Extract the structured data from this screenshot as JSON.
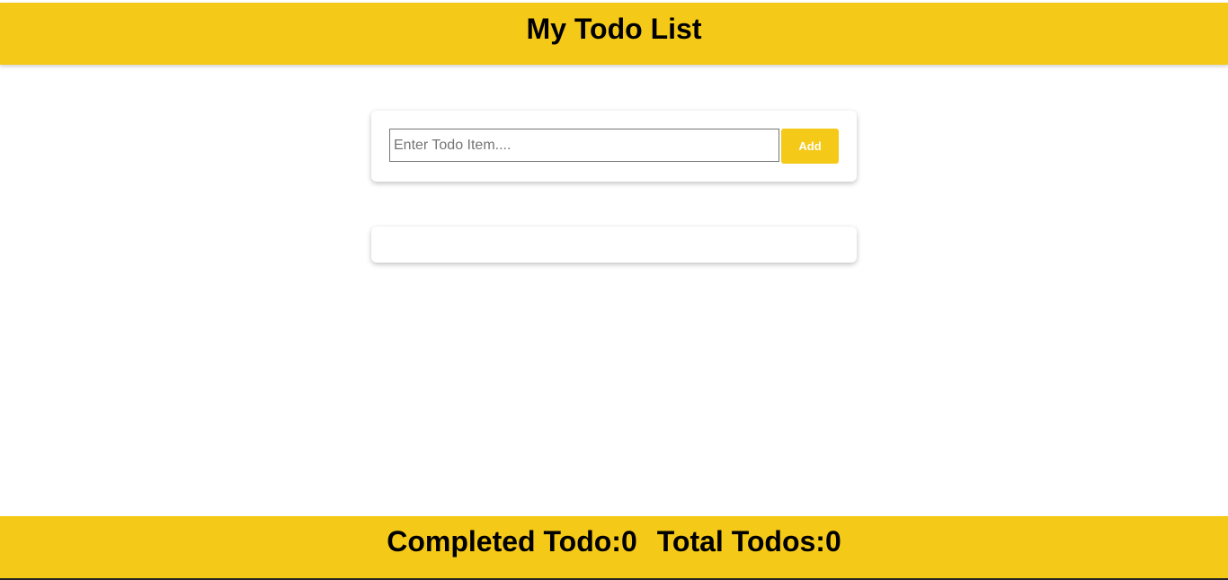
{
  "header": {
    "title": "My Todo List"
  },
  "todo_form": {
    "input_value": "",
    "input_placeholder": "Enter Todo Item....",
    "add_label": "Add"
  },
  "todo_list": {
    "items": []
  },
  "footer": {
    "completed_label": "Completed Todo:",
    "completed_count": "0",
    "total_label": "Total Todos:",
    "total_count": "0"
  },
  "colors": {
    "accent": "#f5c918",
    "background": "#ffffff",
    "text": "#000000"
  }
}
